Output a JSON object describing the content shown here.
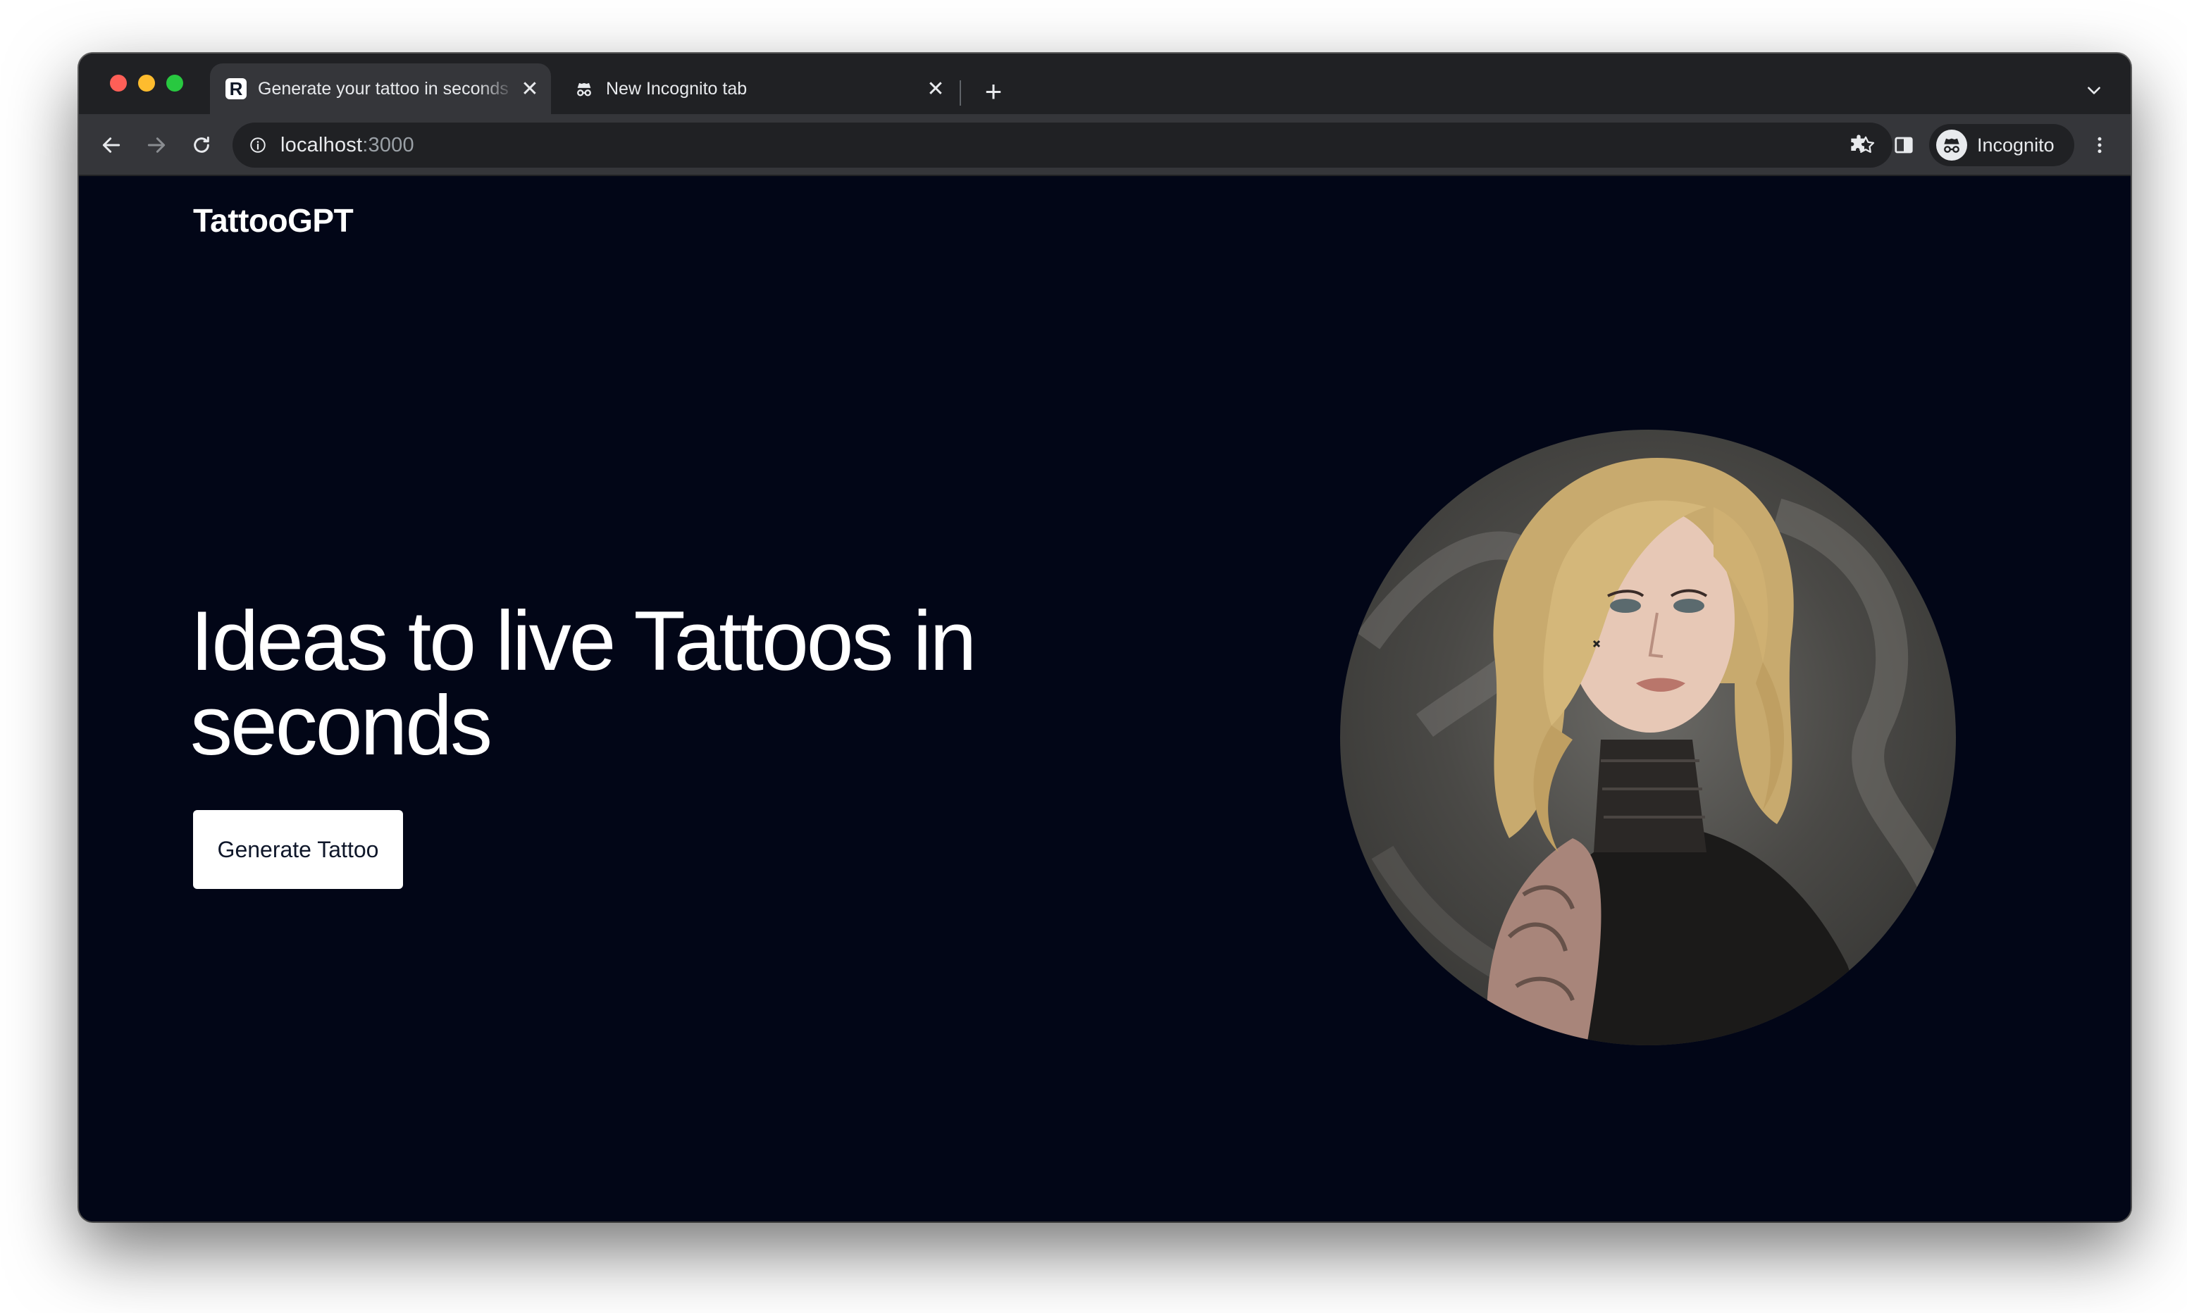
{
  "browser": {
    "tabs": [
      {
        "title": "Generate your tattoo in seconds",
        "favicon": "R",
        "active": true
      },
      {
        "title": "New Incognito tab",
        "favicon": "incognito-icon",
        "active": false
      }
    ],
    "address": {
      "host": "localhost",
      "port": ":3000"
    },
    "profile_label": "Incognito"
  },
  "page": {
    "brand": "TattooGPT",
    "headline": "Ideas to live Tattoos in seconds",
    "cta_label": "Generate Tattoo",
    "background_color": "#020617"
  }
}
